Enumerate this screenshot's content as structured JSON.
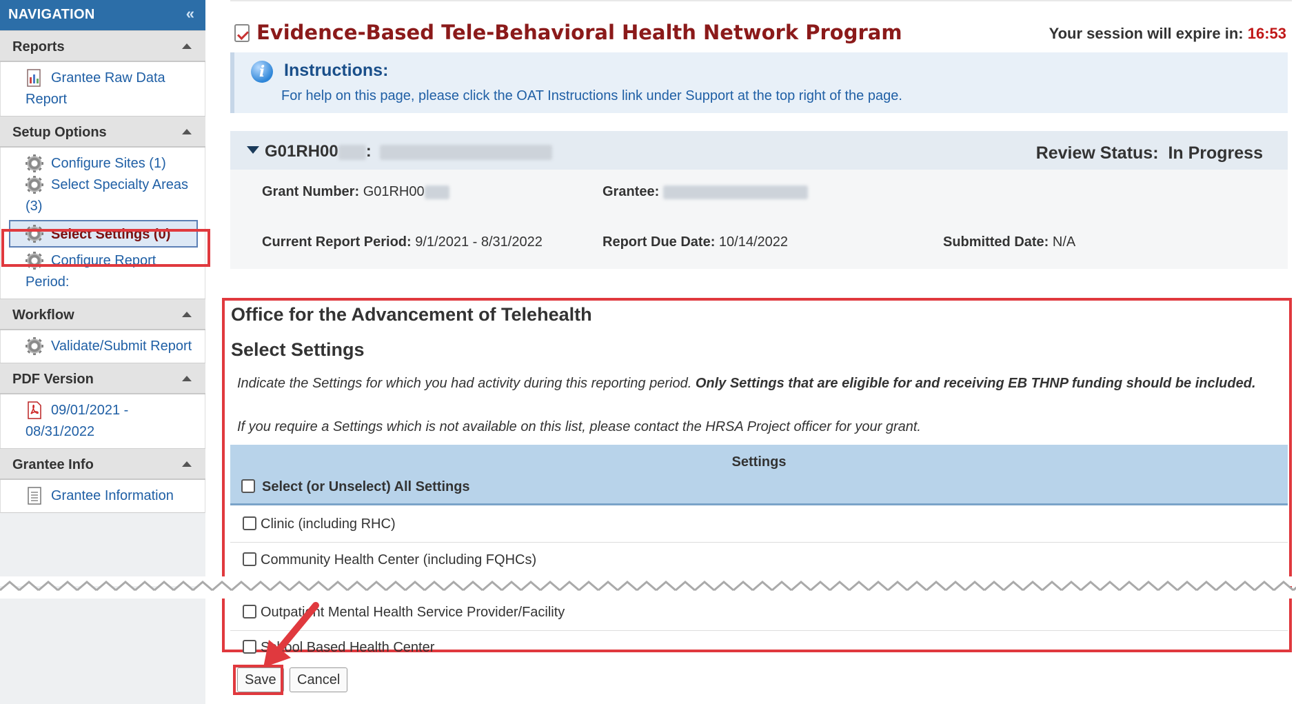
{
  "sidebar": {
    "title": "NAVIGATION",
    "sections": [
      {
        "label": "Reports",
        "items": [
          "Grantee Raw Data Report"
        ]
      },
      {
        "label": "Setup Options",
        "items": [
          "Configure Sites (1)",
          "Select Specialty Areas (3)",
          "Select Settings (0)",
          "Configure Report Period:"
        ]
      },
      {
        "label": "Workflow",
        "items": [
          "Validate/Submit Report"
        ]
      },
      {
        "label": "PDF Version",
        "items": [
          "09/01/2021 - 08/31/2022"
        ]
      },
      {
        "label": "Grantee Info",
        "items": [
          "Grantee Information"
        ]
      }
    ]
  },
  "header": {
    "title": "Evidence-Based Tele-Behavioral Health Network Program",
    "session_label": "Your session will expire in:",
    "session_time": "16:53"
  },
  "instructions": {
    "heading": "Instructions:",
    "text": "For help on this page, please click the OAT Instructions link under Support at the top right of the page."
  },
  "grant": {
    "id": "G01RH00",
    "sep": ":",
    "review_status_label": "Review Status:",
    "review_status": "In Progress",
    "grant_number_label": "Grant Number:",
    "grant_number": "G01RH00",
    "grantee_label": "Grantee:",
    "period_label": "Current Report Period:",
    "period": "9/1/2021 - 8/31/2022",
    "due_label": "Report Due Date:",
    "due": "10/14/2022",
    "submitted_label": "Submitted Date:",
    "submitted": "N/A"
  },
  "form": {
    "org": "Office for the Advancement of Telehealth",
    "heading": "Select Settings",
    "intro_1": "Indicate the Settings for which you had activity during this reporting period.",
    "intro_bold": "Only Settings that are eligible for and receiving EB THNP funding should be included.",
    "intro_2": "If you require a Settings which is not available on this list, please contact the HRSA Project officer for your grant.",
    "table_header": "Settings",
    "select_all": "Select (or Unselect) All Settings",
    "rows": [
      "Clinic (including RHC)",
      "Community Health Center (including FQHCs)",
      "Outpatient Mental Health Service Provider/Facility",
      "School Based Health Center"
    ]
  },
  "buttons": {
    "save": "Save",
    "cancel": "Cancel"
  }
}
